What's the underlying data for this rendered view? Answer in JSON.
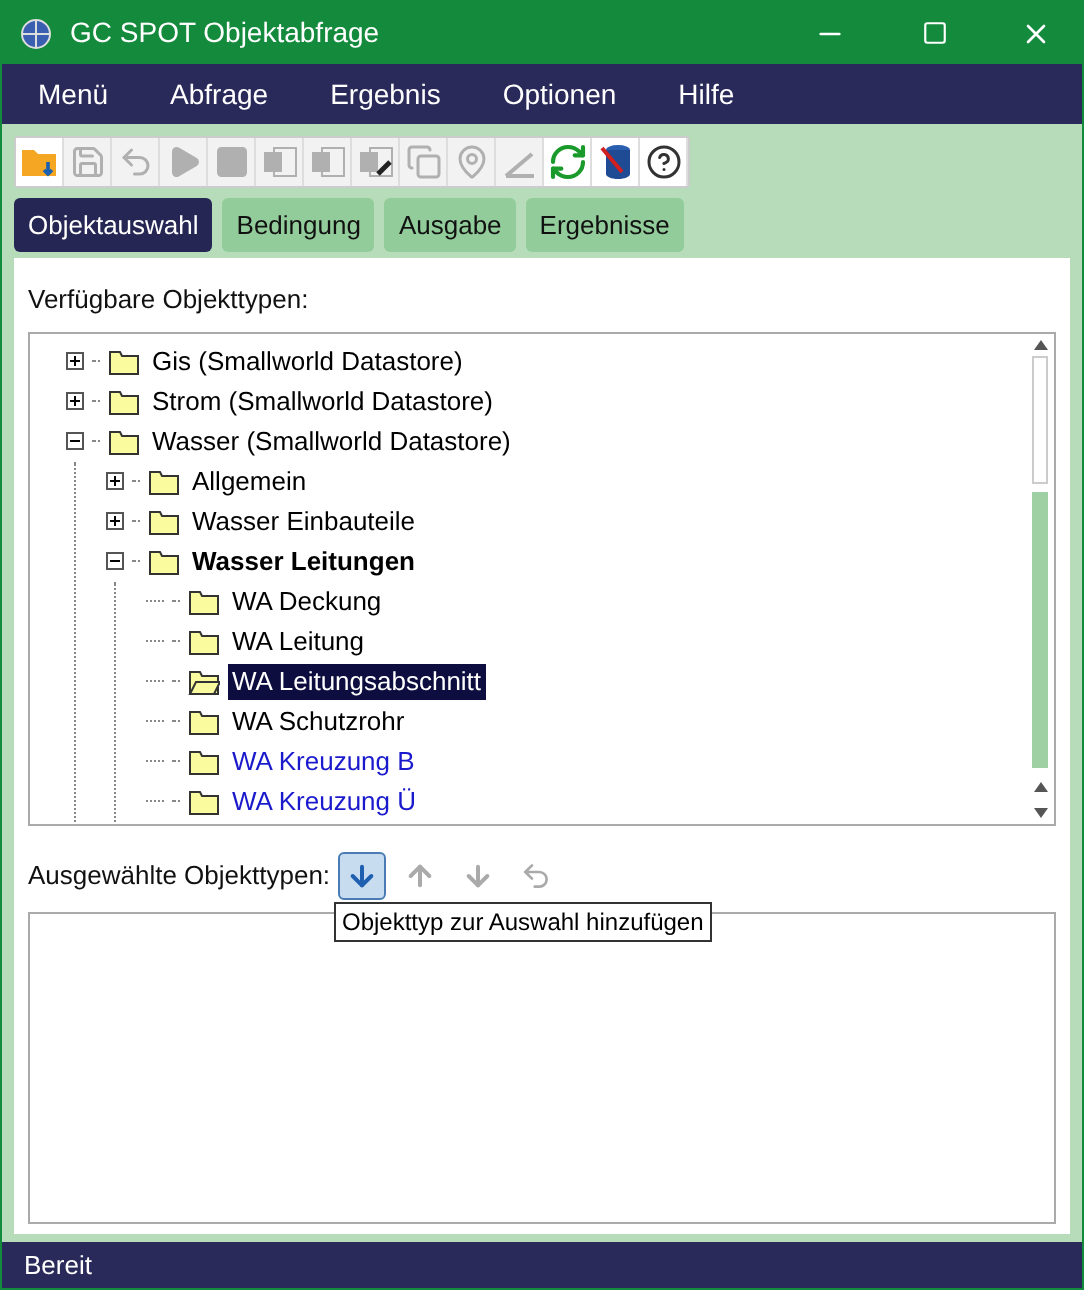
{
  "window": {
    "title": "GC SPOT Objektabfrage"
  },
  "menu": [
    "Menü",
    "Abfrage",
    "Ergebnis",
    "Optionen",
    "Hilfe"
  ],
  "toolbar": [
    {
      "kind": "open",
      "disabled": false
    },
    {
      "kind": "save",
      "disabled": true
    },
    {
      "kind": "undo",
      "disabled": true
    },
    {
      "kind": "play",
      "disabled": true
    },
    {
      "kind": "stop",
      "disabled": true
    },
    {
      "kind": "word",
      "disabled": true
    },
    {
      "kind": "excel",
      "disabled": true
    },
    {
      "kind": "excel-link",
      "disabled": true
    },
    {
      "kind": "copy",
      "disabled": true
    },
    {
      "kind": "pin",
      "disabled": true
    },
    {
      "kind": "angle",
      "disabled": true
    },
    {
      "kind": "refresh",
      "disabled": false
    },
    {
      "kind": "database",
      "disabled": false
    },
    {
      "kind": "help",
      "disabled": false
    }
  ],
  "tabs": [
    {
      "label": "Objektauswahl",
      "selected": true
    },
    {
      "label": "Bedingung",
      "selected": false
    },
    {
      "label": "Ausgabe",
      "selected": false
    },
    {
      "label": "Ergebnisse",
      "selected": false
    }
  ],
  "available": {
    "label": "Verfügbare Objekttypen:",
    "tree": [
      {
        "label": "Gis (Smallworld Datastore)",
        "expanded": false,
        "selected": false,
        "bold": false,
        "color": "#000000"
      },
      {
        "label": "Strom (Smallworld Datastore)",
        "expanded": false,
        "selected": false,
        "bold": false,
        "color": "#000000"
      },
      {
        "label": "Wasser (Smallworld Datastore)",
        "expanded": true,
        "selected": false,
        "bold": false,
        "color": "#000000",
        "children": [
          {
            "label": "Allgemein",
            "expanded": false,
            "selected": false,
            "bold": false,
            "color": "#000000"
          },
          {
            "label": "Wasser Einbauteile",
            "expanded": false,
            "selected": false,
            "bold": false,
            "color": "#000000"
          },
          {
            "label": "Wasser Leitungen",
            "expanded": true,
            "selected": false,
            "bold": true,
            "color": "#000000",
            "children": [
              {
                "label": "WA Deckung",
                "selected": false,
                "bold": false,
                "color": "#000000"
              },
              {
                "label": "WA Leitung",
                "selected": false,
                "bold": false,
                "color": "#000000"
              },
              {
                "label": "WA Leitungsabschnitt",
                "selected": true,
                "bold": false
              },
              {
                "label": "WA Schutzrohr",
                "selected": false,
                "bold": false,
                "color": "#000000"
              },
              {
                "label": "WA Kreuzung B",
                "selected": false,
                "bold": false,
                "color": "#1a1acc"
              },
              {
                "label": "WA Kreuzung Ü",
                "selected": false,
                "bold": false,
                "color": "#1a1acc"
              }
            ]
          }
        ]
      }
    ]
  },
  "selected_types": {
    "label": "Ausgewählte Objekttypen:",
    "buttons": [
      {
        "kind": "add",
        "disabled": false,
        "hovered": true
      },
      {
        "kind": "up",
        "disabled": true,
        "hovered": false
      },
      {
        "kind": "down",
        "disabled": true,
        "hovered": false
      },
      {
        "kind": "undo",
        "disabled": true,
        "hovered": false
      }
    ],
    "tooltip": "Objekttyp zur Auswahl hinzufügen"
  },
  "status_bar": "Bereit"
}
